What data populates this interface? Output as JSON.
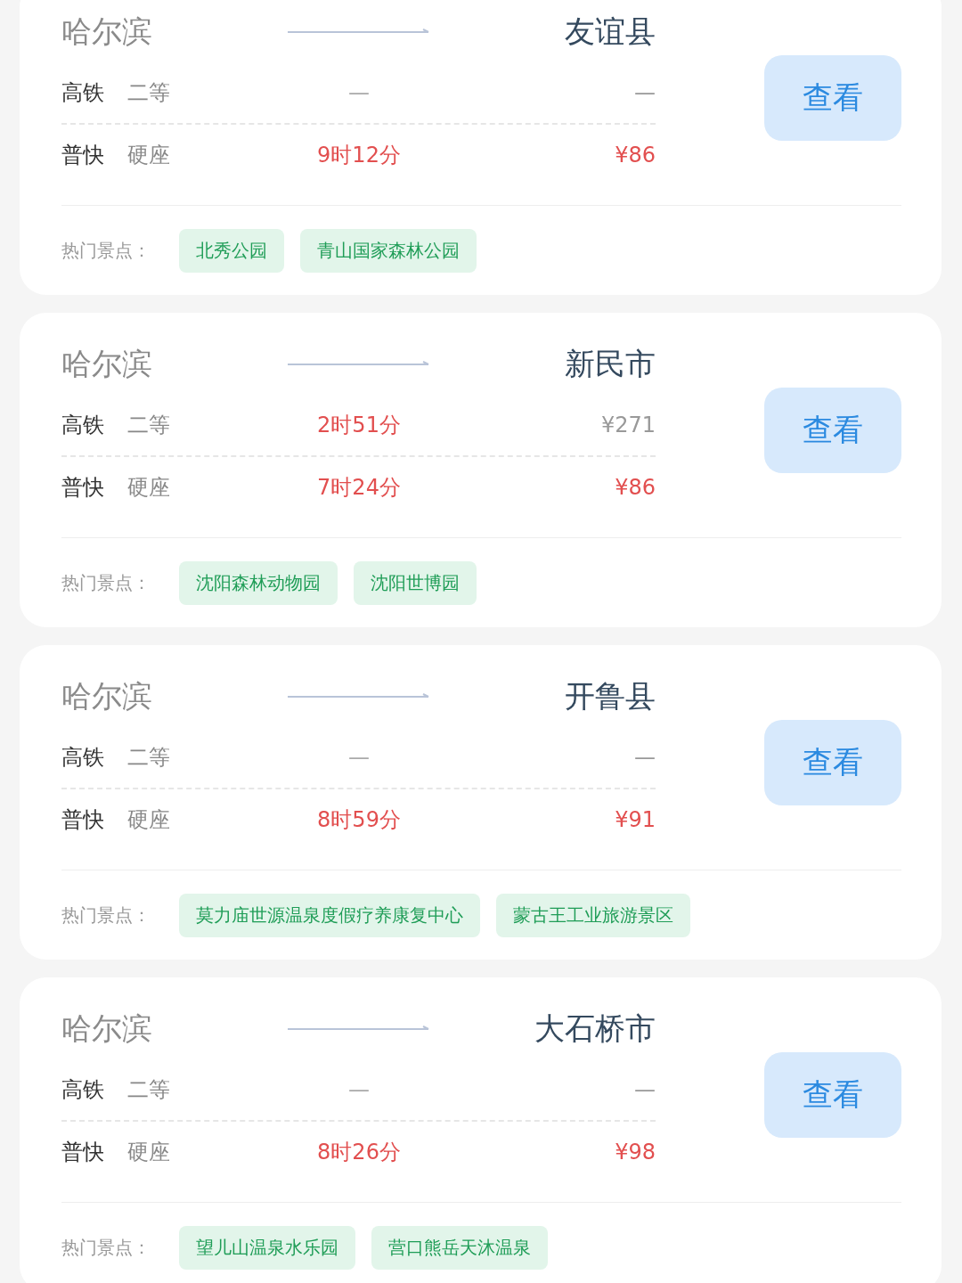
{
  "cards": [
    {
      "origin": "哈尔滨",
      "destination": "友谊县",
      "rows": [
        {
          "train": "高铁",
          "seat": "二等",
          "duration": "—",
          "duration_highlight": false,
          "price": "—",
          "price_highlight": false
        },
        {
          "train": "普快",
          "seat": "硬座",
          "duration": "9时12分",
          "duration_highlight": true,
          "price": "¥86",
          "price_highlight": true
        }
      ],
      "button": "查看",
      "attractions_label": "热门景点：",
      "attractions": [
        "北秀公园",
        "青山国家森林公园"
      ]
    },
    {
      "origin": "哈尔滨",
      "destination": "新民市",
      "rows": [
        {
          "train": "高铁",
          "seat": "二等",
          "duration": "2时51分",
          "duration_highlight": true,
          "price": "¥271",
          "price_highlight": false
        },
        {
          "train": "普快",
          "seat": "硬座",
          "duration": "7时24分",
          "duration_highlight": true,
          "price": "¥86",
          "price_highlight": true
        }
      ],
      "button": "查看",
      "attractions_label": "热门景点：",
      "attractions": [
        "沈阳森林动物园",
        "沈阳世博园"
      ]
    },
    {
      "origin": "哈尔滨",
      "destination": "开鲁县",
      "rows": [
        {
          "train": "高铁",
          "seat": "二等",
          "duration": "—",
          "duration_highlight": false,
          "price": "—",
          "price_highlight": false
        },
        {
          "train": "普快",
          "seat": "硬座",
          "duration": "8时59分",
          "duration_highlight": true,
          "price": "¥91",
          "price_highlight": true
        }
      ],
      "button": "查看",
      "attractions_label": "热门景点：",
      "attractions": [
        "莫力庙世源温泉度假疗养康复中心",
        "蒙古王工业旅游景区"
      ]
    },
    {
      "origin": "哈尔滨",
      "destination": "大石桥市",
      "rows": [
        {
          "train": "高铁",
          "seat": "二等",
          "duration": "—",
          "duration_highlight": false,
          "price": "—",
          "price_highlight": false
        },
        {
          "train": "普快",
          "seat": "硬座",
          "duration": "8时26分",
          "duration_highlight": true,
          "price": "¥98",
          "price_highlight": true
        }
      ],
      "button": "查看",
      "attractions_label": "热门景点：",
      "attractions": [
        "望儿山温泉水乐园",
        "营口熊岳天沐温泉"
      ]
    }
  ]
}
